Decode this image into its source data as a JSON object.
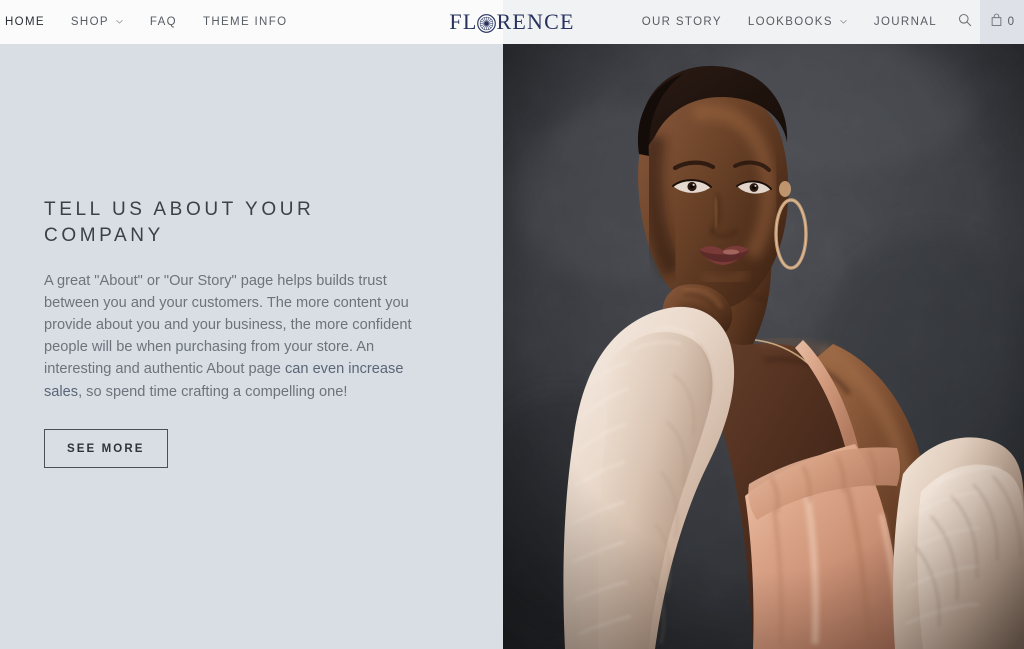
{
  "site": {
    "logo_text_before": "FL",
    "logo_mark": "rosette-medallion-icon",
    "logo_text_after": "RENCE",
    "logo_color": "#27335e"
  },
  "header": {
    "background": "#fbfbfc",
    "nav_left": [
      {
        "label": "HOME",
        "has_dropdown": false
      },
      {
        "label": "SHOP",
        "has_dropdown": true
      },
      {
        "label": "FAQ",
        "has_dropdown": false
      },
      {
        "label": "THEME INFO",
        "has_dropdown": false
      }
    ],
    "nav_right": [
      {
        "label": "OUR STORY",
        "has_dropdown": false
      },
      {
        "label": "LOOKBOOKS",
        "has_dropdown": true
      },
      {
        "label": "JOURNAL",
        "has_dropdown": false
      }
    ],
    "search_icon": "search-icon",
    "cart": {
      "icon": "shopping-bag-icon",
      "count": "0",
      "panel_color": "#dee2e8"
    }
  },
  "main": {
    "background": "#d9dee4",
    "heading": "Tell Us About Your Company",
    "paragraph_part1": "A great \"About\" or \"Our Story\" page helps builds trust between you and your customers. The more content you provide about you and your business, the more confident people will be when purchasing from your store. An interesting and authentic About page ",
    "paragraph_link": "can even increase sales",
    "paragraph_part2": ", so spend time crafting a compelling one!",
    "link_color": "#5b6577",
    "button_label": "SEE MORE"
  },
  "hero_image": {
    "alt": "Fashion model wearing a blush silk slip dress and cream fur stole against a dark textured gray backdrop",
    "backdrop_color": "#3a3c40",
    "dress_color": "#d79e87",
    "fur_color": "#efdfd4"
  }
}
